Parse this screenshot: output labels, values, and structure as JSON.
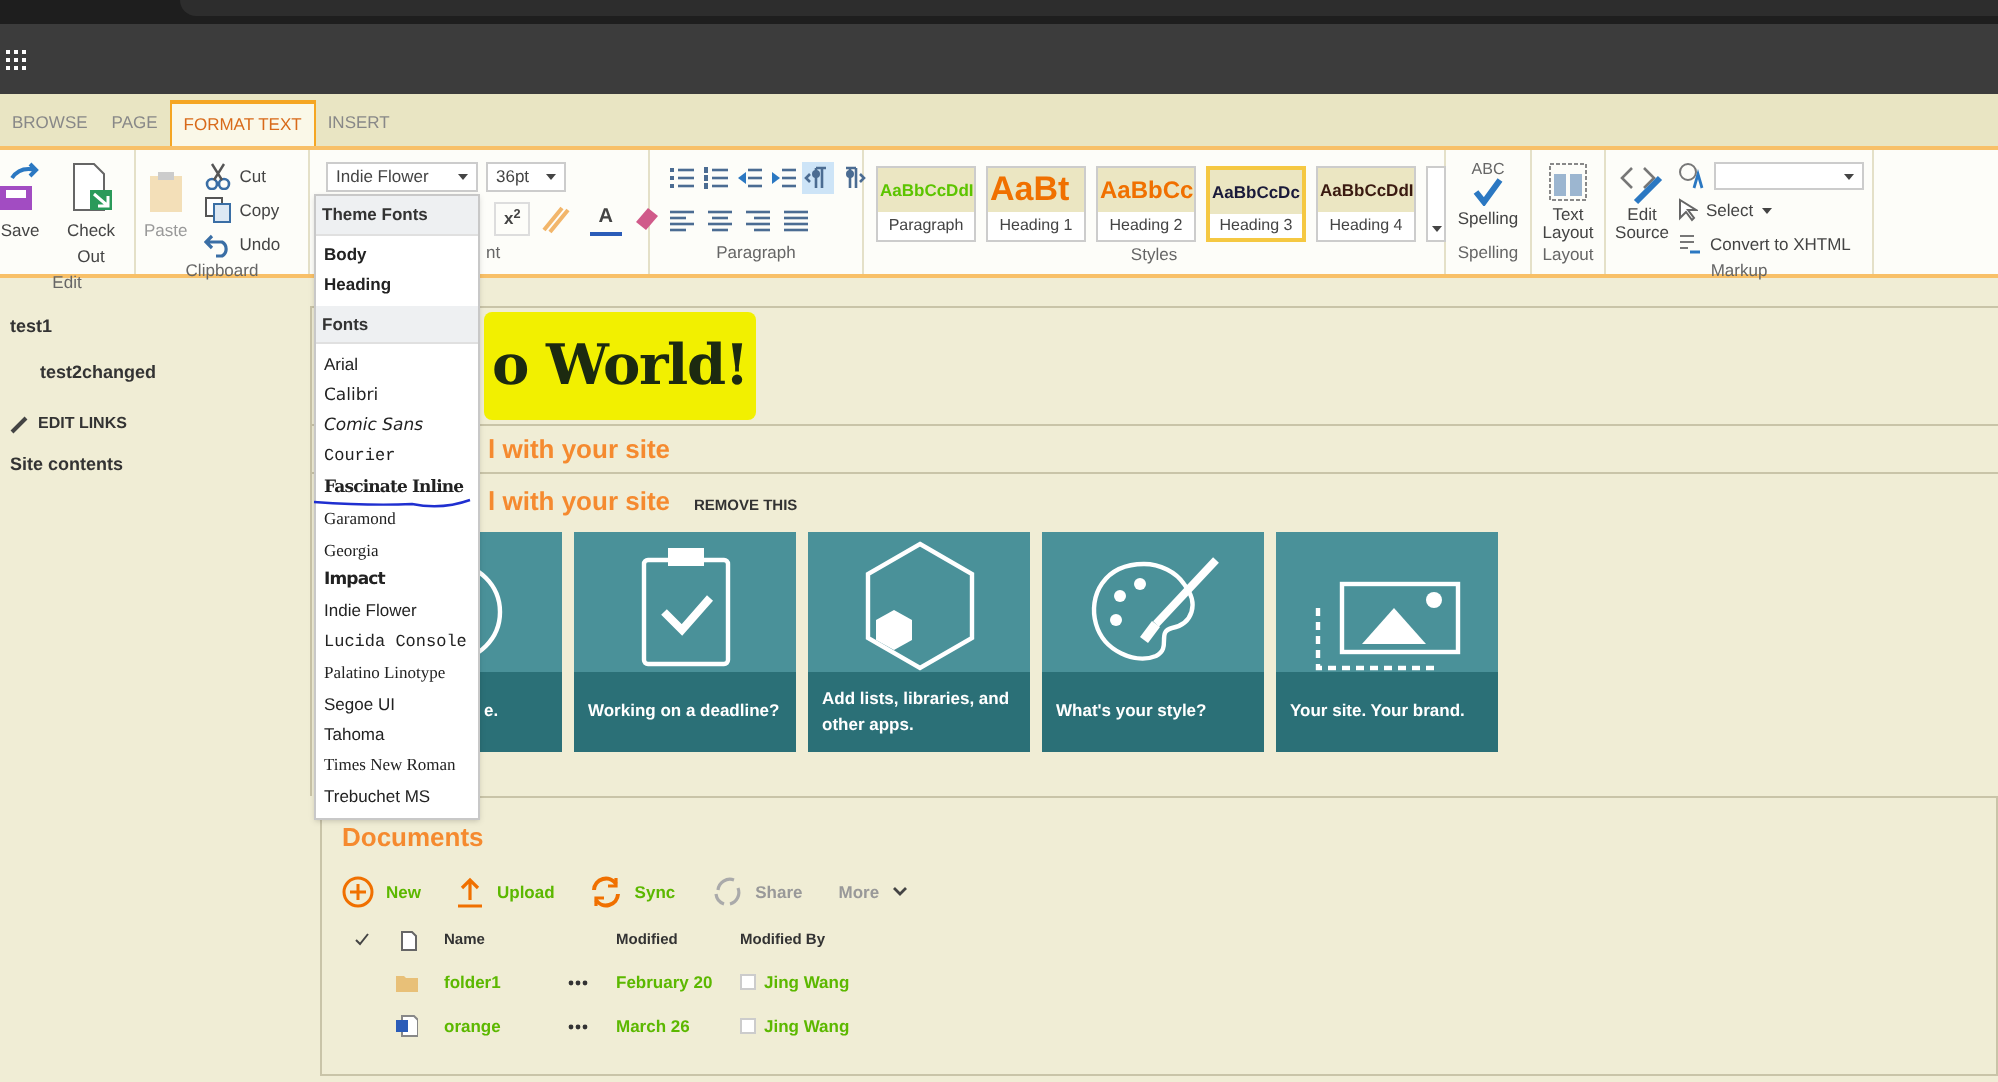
{
  "tabs": [
    {
      "label": "BROWSE",
      "selected": false
    },
    {
      "label": "PAGE",
      "selected": false
    },
    {
      "label": "FORMAT TEXT",
      "selected": true
    },
    {
      "label": "INSERT",
      "selected": false
    }
  ],
  "ribbon": {
    "edit": {
      "buttons": [
        {
          "label": "Save",
          "kind": "save"
        },
        {
          "label": "Check Out",
          "kind": "checkout"
        }
      ],
      "group_label": "Edit"
    },
    "clipboard": {
      "paste": "Paste",
      "small": [
        {
          "label": "Cut",
          "kind": "cut"
        },
        {
          "label": "Copy",
          "kind": "copy"
        },
        {
          "label": "Undo",
          "kind": "undo"
        }
      ],
      "group_label": "Clipboard"
    },
    "font": {
      "font_name": "Indie Flower",
      "font_size": "36pt",
      "superscript": "x$^{2}$",
      "font_color": "A",
      "group_label": "nt"
    },
    "paragraph": {
      "tools": [
        {
          "kind": "bullets",
          "selected": false
        },
        {
          "kind": "numbers",
          "selected": false
        },
        {
          "kind": "outdent",
          "selected": false
        },
        {
          "kind": "indent",
          "selected": false
        },
        {
          "kind": "ltr",
          "selected": true
        },
        {
          "kind": "rtl",
          "selected": false
        }
      ],
      "aligns": [
        {
          "kind": "left"
        },
        {
          "kind": "center"
        },
        {
          "kind": "right"
        },
        {
          "kind": "justify"
        }
      ],
      "group_label": "Paragraph"
    },
    "styles": {
      "items": [
        {
          "sample": "AaBbCcDdI",
          "label": "Paragraph",
          "selected": false,
          "color": "#5cc400",
          "kind": "small"
        },
        {
          "sample": "AaBt",
          "label": "Heading 1",
          "selected": false,
          "color": "#f07000",
          "kind": "large"
        },
        {
          "sample": "AaBbCc",
          "label": "Heading 2",
          "selected": false,
          "color": "#f07000",
          "kind": "medium"
        },
        {
          "sample": "AaBbCcDc",
          "label": "Heading 3",
          "selected": true,
          "color": "#1a1a3a",
          "kind": "small"
        },
        {
          "sample": "AaBbCcDdI",
          "label": "Heading 4",
          "selected": false,
          "color": "#3a1a10",
          "kind": "small"
        }
      ],
      "group_label": "Styles"
    },
    "spelling": {
      "icon_text": "ABC",
      "label": "Spelling",
      "group_label": "Spelling"
    },
    "layout": {
      "label": "Text Layout",
      "group_label": "Layout"
    },
    "markup": {
      "edit_source": "Edit Source",
      "select": "Select",
      "convert": "Convert to XHTML",
      "group_label": "Markup"
    }
  },
  "font_menu": {
    "sections": [
      {
        "heading": "Theme Fonts",
        "items": [
          {
            "label": "Body",
            "kind": "bold",
            "annotated": false
          },
          {
            "label": "Heading",
            "kind": "bold",
            "annotated": false
          }
        ]
      },
      {
        "heading": "Fonts",
        "items": [
          {
            "label": "Arial",
            "kind": "sans",
            "annotated": false
          },
          {
            "label": "Calibri",
            "kind": "small",
            "annotated": false
          },
          {
            "label": "Comic Sans",
            "kind": "italic",
            "annotated": false
          },
          {
            "label": "Courier",
            "kind": "mono",
            "annotated": false
          },
          {
            "label": "Fascinate Inline",
            "kind": "display",
            "annotated": true
          },
          {
            "label": "Garamond",
            "kind": "smallserif",
            "annotated": false
          },
          {
            "label": "Georgia",
            "kind": "serif",
            "annotated": false
          },
          {
            "label": "Impact",
            "kind": "heavy",
            "annotated": false
          },
          {
            "label": "Indie Flower",
            "kind": "sans",
            "annotated": false
          },
          {
            "label": "Lucida Console",
            "kind": "mono",
            "annotated": false
          },
          {
            "label": "Palatino Linotype",
            "kind": "serif",
            "annotated": false
          },
          {
            "label": "Segoe UI",
            "kind": "sans",
            "annotated": false
          },
          {
            "label": "Tahoma",
            "kind": "sans",
            "annotated": false
          },
          {
            "label": "Times New Roman",
            "kind": "smallserif",
            "annotated": false
          },
          {
            "label": "Trebuchet MS",
            "kind": "sans",
            "annotated": false
          }
        ]
      }
    ]
  },
  "nav": [
    {
      "label": "test1",
      "children": [
        {
          "label": "test2changed"
        }
      ]
    }
  ],
  "edit_links": "EDIT LINKS",
  "site_contents": "Site contents",
  "page": {
    "heading": "o World!",
    "banner_title": "l with your site",
    "get_started": {
      "title": "l with your site",
      "remove": "REMOVE THIS"
    },
    "tiles": [
      {
        "label": "e.",
        "kind": "share"
      },
      {
        "label": "Working on a deadline?",
        "kind": "clipboard"
      },
      {
        "label": "Add lists, libraries, and other apps.",
        "kind": "apps"
      },
      {
        "label": "What's your style?",
        "kind": "palette"
      },
      {
        "label": "Your site. Your brand.",
        "kind": "image"
      }
    ]
  },
  "documents": {
    "title": "Documents",
    "actions": [
      {
        "label": "New",
        "kind": "new",
        "disabled": false
      },
      {
        "label": "Upload",
        "kind": "upload",
        "disabled": false
      },
      {
        "label": "Sync",
        "kind": "sync",
        "disabled": false
      },
      {
        "label": "Share",
        "kind": "share",
        "disabled": true
      },
      {
        "label": "More",
        "kind": "more",
        "disabled": true
      }
    ],
    "columns": [
      "Name",
      "Modified",
      "Modified By"
    ],
    "rows": [
      {
        "kind": "folder",
        "name": "folder1",
        "modified": "February 20",
        "modified_by": "Jing Wang"
      },
      {
        "kind": "word",
        "name": "orange",
        "modified": "March 26",
        "modified_by": "Jing Wang"
      }
    ]
  }
}
